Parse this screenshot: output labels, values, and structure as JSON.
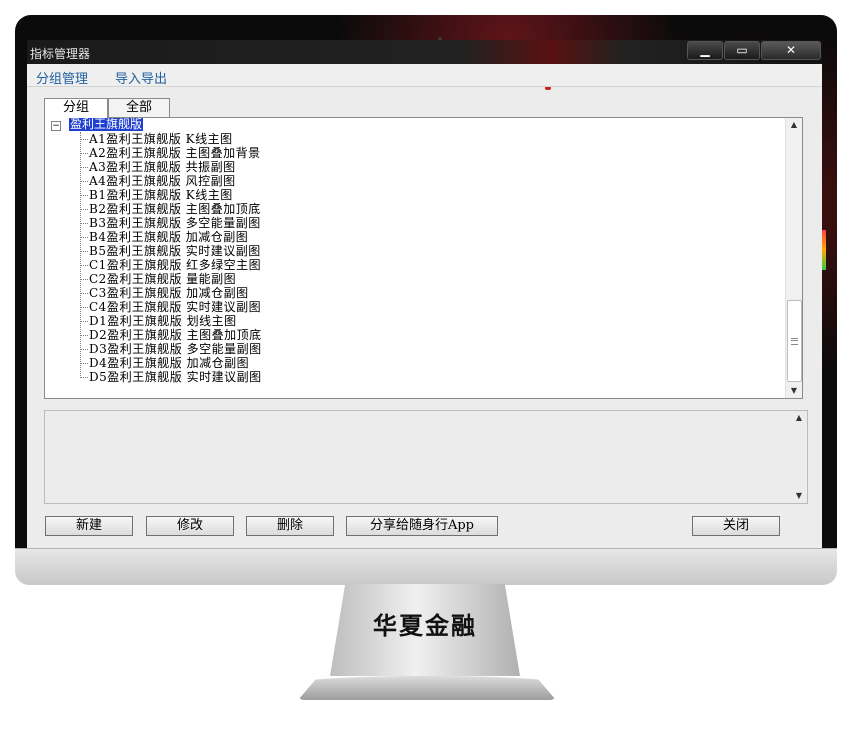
{
  "window": {
    "title": "指标管理器",
    "controls": {
      "minimize": "▁",
      "maximize": "▭",
      "close": "✕"
    }
  },
  "menu": [
    "分组管理",
    "导入导出"
  ],
  "tabs": [
    "分组",
    "全部"
  ],
  "tree": {
    "root": "盈利王旗舰版",
    "items": [
      "A1盈利王旗舰版 K线主图",
      "A2盈利王旗舰版 主图叠加背景",
      "A3盈利王旗舰版 共振副图",
      "A4盈利王旗舰版 风控副图",
      "B1盈利王旗舰版 K线主图",
      "B2盈利王旗舰版 主图叠加顶底",
      "B3盈利王旗舰版 多空能量副图",
      "B4盈利王旗舰版 加减仓副图",
      "B5盈利王旗舰版 实时建议副图",
      "C1盈利王旗舰版 红多绿空主图",
      "C2盈利王旗舰版 量能副图",
      "C3盈利王旗舰版 加减仓副图",
      "C4盈利王旗舰版 实时建议副图",
      "D1盈利王旗舰版 划线主图",
      "D2盈利王旗舰版 主图叠加顶底",
      "D3盈利王旗舰版 多空能量副图",
      "D4盈利王旗舰版 加减仓副图",
      "D5盈利王旗舰版 实时建议副图"
    ],
    "expander": "−"
  },
  "scroll": {
    "up": "▲",
    "down": "▼"
  },
  "buttons": {
    "new": "新建",
    "edit": "修改",
    "delete": "删除",
    "share": "分享给随身行App",
    "close": "关闭"
  },
  "brand": "华夏金融"
}
